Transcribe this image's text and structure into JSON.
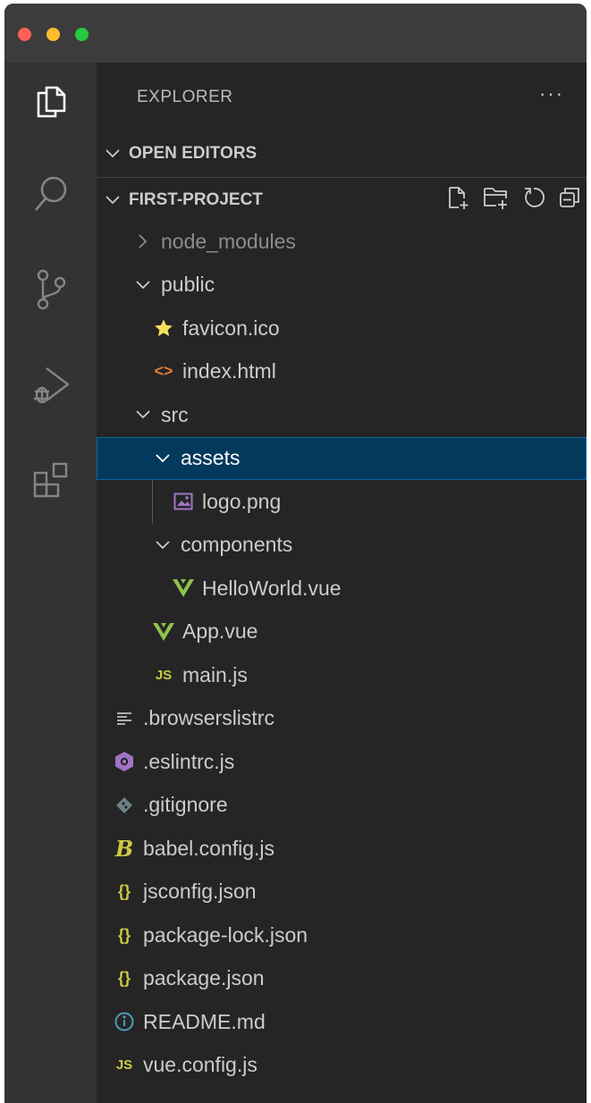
{
  "sidebar": {
    "title": "EXPLORER",
    "more": "···",
    "open_editors": "OPEN EDITORS",
    "project": "FIRST-PROJECT"
  },
  "tree": [
    {
      "label": "node_modules",
      "type": "folder",
      "state": "collapsed"
    },
    {
      "label": "public",
      "type": "folder",
      "state": "expanded"
    },
    {
      "label": "favicon.ico",
      "type": "file",
      "icon": "star-icon"
    },
    {
      "label": "index.html",
      "type": "file",
      "icon": "html-icon"
    },
    {
      "label": "src",
      "type": "folder",
      "state": "expanded"
    },
    {
      "label": "assets",
      "type": "folder",
      "state": "expanded",
      "selected": true
    },
    {
      "label": "logo.png",
      "type": "file",
      "icon": "image-icon"
    },
    {
      "label": "components",
      "type": "folder",
      "state": "expanded"
    },
    {
      "label": "HelloWorld.vue",
      "type": "file",
      "icon": "vue-icon"
    },
    {
      "label": "App.vue",
      "type": "file",
      "icon": "vue-icon"
    },
    {
      "label": "main.js",
      "type": "file",
      "icon": "js-icon"
    },
    {
      "label": ".browserslistrc",
      "type": "file",
      "icon": "lines-icon"
    },
    {
      "label": ".eslintrc.js",
      "type": "file",
      "icon": "eslint-icon"
    },
    {
      "label": ".gitignore",
      "type": "file",
      "icon": "git-icon"
    },
    {
      "label": "babel.config.js",
      "type": "file",
      "icon": "babel-icon"
    },
    {
      "label": "jsconfig.json",
      "type": "file",
      "icon": "json-icon"
    },
    {
      "label": "package-lock.json",
      "type": "file",
      "icon": "json-icon"
    },
    {
      "label": "package.json",
      "type": "file",
      "icon": "json-icon"
    },
    {
      "label": "README.md",
      "type": "file",
      "icon": "info-icon"
    },
    {
      "label": "vue.config.js",
      "type": "file",
      "icon": "js-icon"
    }
  ],
  "icon_text": {
    "js": "JS",
    "json": "{}",
    "html": "<>",
    "babel": "B"
  },
  "colors": {
    "selection": "#04395e",
    "vue": "#8dc149",
    "js": "#cbcb41",
    "html": "#e37933",
    "eslint": "#a074c4",
    "star": "#f1e05a"
  }
}
